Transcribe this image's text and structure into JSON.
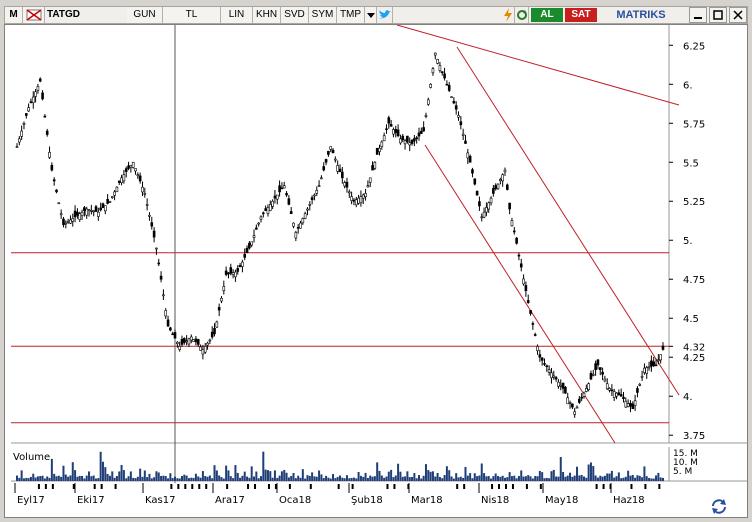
{
  "toolbar": {
    "m_label": "M",
    "symbol": "TATGD",
    "period": "GUN",
    "currency": "TL",
    "scale_lin": "LIN",
    "khn": "KHN",
    "svd": "SVD",
    "sym": "SYM",
    "tmp": "TMP",
    "buy": "AL",
    "sell": "SAT",
    "brand": "MATRIKS",
    "colors": {
      "buy": "#1a8a2a",
      "sell": "#c81e1e",
      "brand": "#2b4fa0"
    }
  },
  "chart_data": {
    "type": "candlestick",
    "y_ticks": [
      "6.25",
      "6.",
      "5.75",
      "5.5",
      "5.25",
      "5.",
      "4.75",
      "4.5",
      "4.32",
      "4.25",
      "4.",
      "3.75"
    ],
    "x_ticks": [
      "Eyl17",
      "Eki17",
      "Kas17",
      "Ara17",
      "Oca18",
      "Şub18",
      "Mar18",
      "Nis18",
      "May18",
      "Haz18"
    ],
    "ylim": [
      3.7,
      6.38
    ],
    "horizontal_lines": [
      4.92,
      4.32,
      3.83
    ],
    "volume_label": "Volume",
    "volume_ticks": [
      "15. M",
      "10. M",
      "5. M"
    ],
    "price_path": [
      [
        0,
        5.6
      ],
      [
        5,
        5.85
      ],
      [
        10,
        6.02
      ],
      [
        15,
        5.45
      ],
      [
        20,
        5.1
      ],
      [
        25,
        5.15
      ],
      [
        30,
        5.2
      ],
      [
        35,
        5.18
      ],
      [
        40,
        5.25
      ],
      [
        45,
        5.4
      ],
      [
        50,
        5.5
      ],
      [
        55,
        5.3
      ],
      [
        60,
        4.95
      ],
      [
        65,
        4.45
      ],
      [
        70,
        4.32
      ],
      [
        75,
        4.38
      ],
      [
        80,
        4.3
      ],
      [
        85,
        4.4
      ],
      [
        90,
        4.78
      ],
      [
        95,
        4.8
      ],
      [
        100,
        4.95
      ],
      [
        105,
        5.15
      ],
      [
        110,
        5.25
      ],
      [
        115,
        5.35
      ],
      [
        120,
        5.05
      ],
      [
        125,
        5.2
      ],
      [
        130,
        5.35
      ],
      [
        135,
        5.6
      ],
      [
        140,
        5.4
      ],
      [
        145,
        5.25
      ],
      [
        150,
        5.3
      ],
      [
        155,
        5.55
      ],
      [
        160,
        5.75
      ],
      [
        165,
        5.65
      ],
      [
        170,
        5.62
      ],
      [
        175,
        5.7
      ],
      [
        180,
        6.2
      ],
      [
        185,
        6.0
      ],
      [
        190,
        5.8
      ],
      [
        195,
        5.5
      ],
      [
        200,
        5.15
      ],
      [
        205,
        5.3
      ],
      [
        210,
        5.45
      ],
      [
        212,
        5.2
      ],
      [
        215,
        4.98
      ],
      [
        220,
        4.6
      ],
      [
        225,
        4.25
      ],
      [
        230,
        4.15
      ],
      [
        235,
        4.05
      ],
      [
        240,
        3.9
      ],
      [
        245,
        4.05
      ],
      [
        250,
        4.2
      ],
      [
        255,
        4.05
      ],
      [
        260,
        4.0
      ],
      [
        265,
        3.92
      ],
      [
        270,
        4.18
      ],
      [
        275,
        4.2
      ],
      [
        278,
        4.3
      ]
    ],
    "volume_levels": [
      1,
      1,
      2,
      1,
      1,
      1,
      1,
      3,
      1,
      1,
      2,
      1,
      1,
      1,
      1,
      4,
      2,
      1,
      1,
      1,
      3,
      2,
      1,
      1,
      5,
      2,
      1,
      1,
      2,
      1,
      1,
      3,
      1,
      2,
      1,
      1,
      6,
      4,
      3,
      2,
      1,
      2,
      1,
      1,
      2,
      3,
      2,
      1,
      1,
      2,
      1,
      1,
      1,
      3,
      1,
      2,
      1,
      2,
      1,
      1,
      4,
      2,
      1,
      1,
      1,
      1,
      2,
      1,
      1,
      1
    ]
  }
}
